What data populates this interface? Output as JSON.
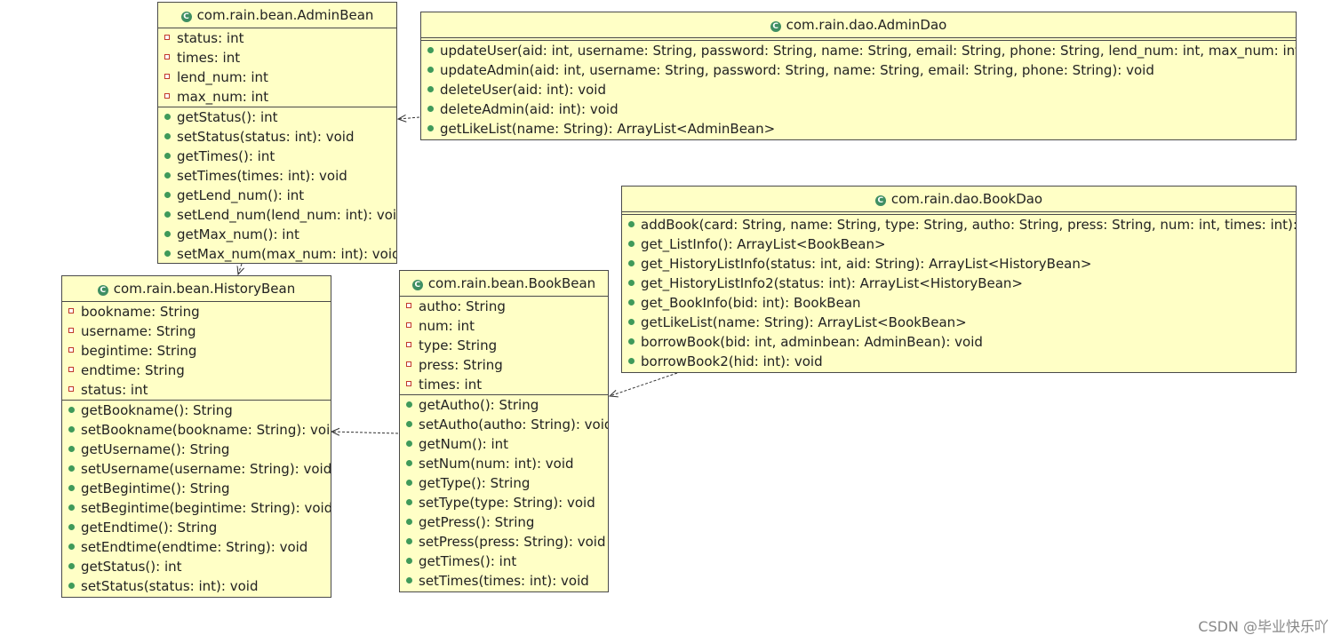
{
  "classes": {
    "admin_bean": {
      "name": "com.rain.bean.AdminBean",
      "fields": [
        "status: int",
        "times: int",
        "lend_num: int",
        "max_num: int"
      ],
      "methods": [
        "getStatus(): int",
        "setStatus(status: int): void",
        "getTimes(): int",
        "setTimes(times: int): void",
        "getLend_num(): int",
        "setLend_num(lend_num: int): void",
        "getMax_num(): int",
        "setMax_num(max_num: int): void"
      ]
    },
    "admin_dao": {
      "name": "com.rain.dao.AdminDao",
      "fields": [],
      "methods": [
        "updateUser(aid: int, username: String, password: String, name: String, email: String, phone: String, lend_num: int, max_num: int): void",
        "updateAdmin(aid: int, username: String, password: String, name: String, email: String, phone: String): void",
        "deleteUser(aid: int): void",
        "deleteAdmin(aid: int): void",
        "getLikeList(name: String): ArrayList<AdminBean>"
      ]
    },
    "book_dao": {
      "name": "com.rain.dao.BookDao",
      "fields": [],
      "methods": [
        "addBook(card: String, name: String, type: String, autho: String, press: String, num: int, times: int): void",
        "get_ListInfo(): ArrayList<BookBean>",
        "get_HistoryListInfo(status: int, aid: String): ArrayList<HistoryBean>",
        "get_HistoryListInfo2(status: int): ArrayList<HistoryBean>",
        "get_BookInfo(bid: int): BookBean",
        "getLikeList(name: String): ArrayList<BookBean>",
        "borrowBook(bid: int, adminbean: AdminBean): void",
        "borrowBook2(hid: int): void"
      ]
    },
    "history_bean": {
      "name": "com.rain.bean.HistoryBean",
      "fields": [
        "bookname: String",
        "username: String",
        "begintime: String",
        "endtime: String",
        "status: int"
      ],
      "methods": [
        "getBookname(): String",
        "setBookname(bookname: String): void",
        "getUsername(): String",
        "setUsername(username: String): void",
        "getBegintime(): String",
        "setBegintime(begintime: String): void",
        "getEndtime(): String",
        "setEndtime(endtime: String): void",
        "getStatus(): int",
        "setStatus(status: int): void"
      ]
    },
    "book_bean": {
      "name": "com.rain.bean.BookBean",
      "fields": [
        "autho: String",
        "num: int",
        "type: String",
        "press: String",
        "times: int"
      ],
      "methods": [
        "getAutho(): String",
        "setAutho(autho: String): void",
        "getNum(): int",
        "setNum(num: int): void",
        "getType(): String",
        "setType(type: String): void",
        "getPress(): String",
        "setPress(press: String): void",
        "getTimes(): int",
        "setTimes(times: int): void"
      ]
    }
  },
  "watermark": "CSDN @毕业快乐吖",
  "colors": {
    "class_fill": "#ffffc6",
    "border": "#4a4a4a",
    "method_icon": "#3f9a5a",
    "field_icon": "#c0392b"
  },
  "icons": {
    "class": "class-c-icon",
    "field": "private-field-icon",
    "method": "public-method-icon"
  }
}
